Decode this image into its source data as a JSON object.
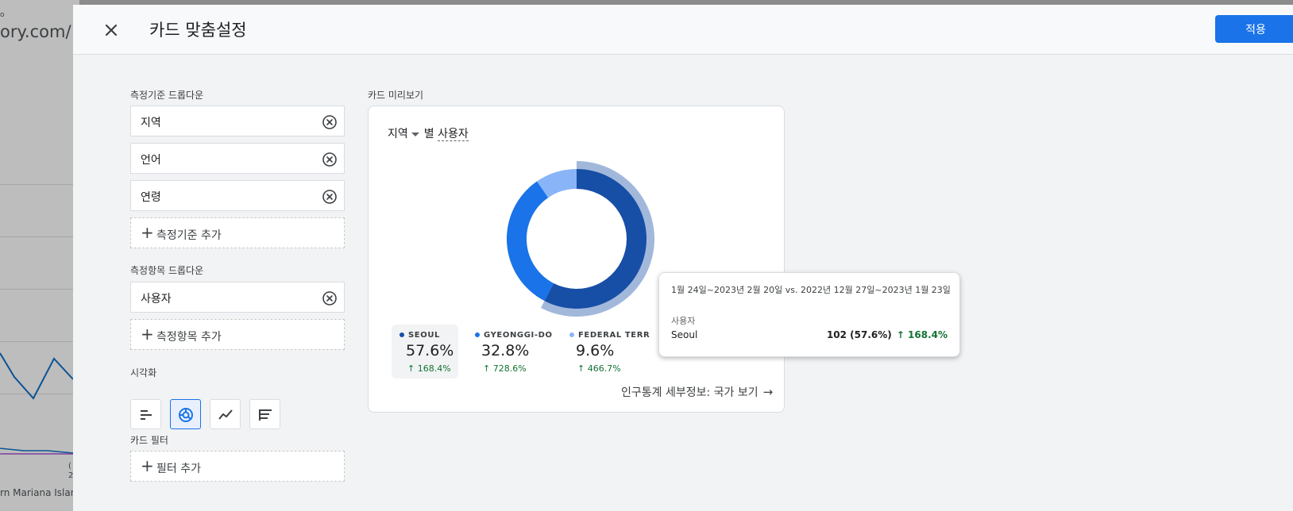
{
  "background_page": {
    "url_fragment": "ory.com/",
    "url_small": "o",
    "footer_text": "rn Mariana Island",
    "tick_label": "(",
    "tick_label_2": "2"
  },
  "panel": {
    "title": "카드 맞춤설정",
    "apply_label": "적용"
  },
  "config": {
    "dimensions_label": "측정기준 드롭다운",
    "dimensions": [
      "지역",
      "언어",
      "연령"
    ],
    "add_dimension_label": "측정기준 추가",
    "metrics_label": "측정항목 드롭다운",
    "metrics": [
      "사용자"
    ],
    "add_metric_label": "측정항목 추가",
    "visualization_label": "시각화",
    "visualization_options": [
      "bar-chart-icon",
      "donut-chart-icon",
      "line-chart-icon",
      "table-icon"
    ],
    "visualization_selected": "donut-chart-icon",
    "filter_label": "카드 필터",
    "add_filter_label": "필터 추가"
  },
  "preview": {
    "label": "카드 미리보기",
    "dimension": "지역",
    "by_text": "별",
    "metric": "사용자",
    "link_text": "인구통계 세부정보: 국가 보기",
    "legend": [
      {
        "name": "SEOUL",
        "value": "57.6%",
        "change": "168.4%",
        "color": "#174ea6"
      },
      {
        "name": "GYEONGGI-DO",
        "value": "32.8%",
        "change": "728.6%",
        "color": "#1a73e8"
      },
      {
        "name": "FEDERAL TERR",
        "value": "9.6%",
        "change": "466.7%",
        "color": "#8ab4f8"
      }
    ]
  },
  "chart_data": {
    "type": "pie",
    "categories": [
      "SEOUL",
      "GYEONGGI-DO",
      "FEDERAL TERR"
    ],
    "values": [
      57.6,
      32.8,
      9.6
    ],
    "changes": [
      "168.4%",
      "728.6%",
      "466.7%"
    ],
    "colors": [
      "#174ea6",
      "#1a73e8",
      "#8ab4f8"
    ],
    "highlighted": "SEOUL",
    "title": "지역 별 사용자"
  },
  "tooltip": {
    "date_range": "1월 24일~2023년 2월 20일 vs. 2022년 12월 27일~2023년 1월 23일",
    "metric_label": "사용자",
    "row_name": "Seoul",
    "row_value": "102 (57.6%)",
    "row_change": "↑ 168.4%"
  }
}
